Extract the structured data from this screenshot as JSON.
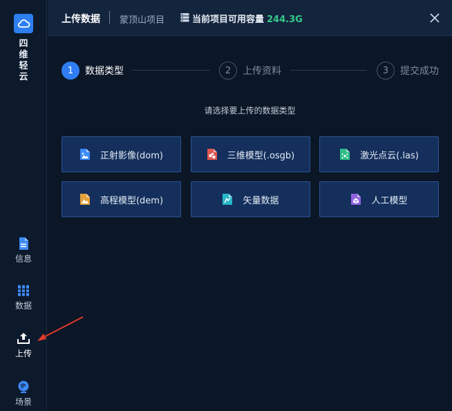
{
  "sidebar": {
    "brand": [
      "四",
      "维",
      "轻",
      "云"
    ],
    "items": [
      {
        "label": "信息",
        "icon": "document-icon"
      },
      {
        "label": "数据",
        "icon": "database-icon"
      },
      {
        "label": "上传",
        "icon": "upload-icon"
      },
      {
        "label": "场景",
        "icon": "globe-icon"
      }
    ]
  },
  "header": {
    "title": "上传数据",
    "project": "蒙顶山项目",
    "capacity_label": "当前项目可用容量",
    "capacity_value": "244.3G"
  },
  "steps": [
    {
      "number": "1",
      "label": "数据类型",
      "active": true
    },
    {
      "number": "2",
      "label": "上传资料",
      "active": false
    },
    {
      "number": "3",
      "label": "提交成功",
      "active": false
    }
  ],
  "prompt": "请选择要上传的数据类型",
  "cards": [
    {
      "label": "正射影像(dom)",
      "icon": "image-file-icon",
      "color": "#3d8bf7"
    },
    {
      "label": "三维模型(.osgb)",
      "icon": "model-file-icon",
      "color": "#e0564f"
    },
    {
      "label": "激光点云(.las)",
      "icon": "pointcloud-file-icon",
      "color": "#2fbf86"
    },
    {
      "label": "高程模型(dem)",
      "icon": "elevation-file-icon",
      "color": "#e3a23a"
    },
    {
      "label": "矢量数据",
      "icon": "vector-file-icon",
      "color": "#27b6c9"
    },
    {
      "label": "人工模型",
      "icon": "cube-file-icon",
      "color": "#8f62e0"
    }
  ],
  "colors": {
    "accent": "#2f7ef5",
    "capacity": "#35c98a",
    "card_bg": "#142f5c",
    "annotation_arrow": "#e03a2c"
  }
}
